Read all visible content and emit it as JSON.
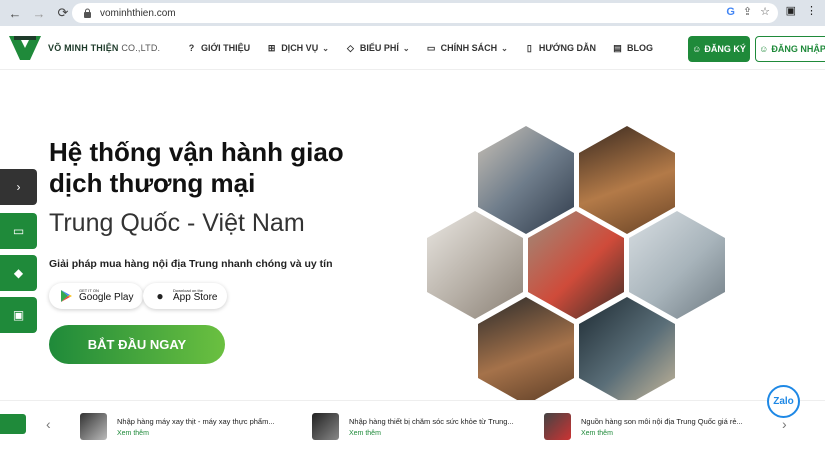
{
  "browser": {
    "url": "vominhthien.com",
    "icons": [
      "back-icon",
      "forward-icon",
      "reload-icon",
      "lock-icon",
      "google-icon",
      "share-icon",
      "star-icon",
      "sidebar-icon",
      "menu-icon"
    ]
  },
  "header": {
    "brand": "VÕ MINH THIỆN",
    "brand_sub": "CO.,LTD.",
    "menu": [
      {
        "label": "GIỚI THIỆU",
        "icon": "help-circle-icon",
        "dropdown": false
      },
      {
        "label": "DỊCH VỤ",
        "icon": "grid-icon",
        "dropdown": true
      },
      {
        "label": "BIỂU PHÍ",
        "icon": "tag-icon",
        "dropdown": true
      },
      {
        "label": "CHÍNH SÁCH",
        "icon": "briefcase-icon",
        "dropdown": true
      },
      {
        "label": "HƯỚNG DẪN",
        "icon": "document-icon",
        "dropdown": false
      },
      {
        "label": "BLOG",
        "icon": "newspaper-icon",
        "dropdown": false
      }
    ],
    "register_label": "ĐĂNG KÝ",
    "login_label": "ĐĂNG NHẬP"
  },
  "hero": {
    "title": "Hệ thống vận hành giao dịch thương mại",
    "subtitle": "Trung Quốc - Việt Nam",
    "tagline": "Giải pháp mua hàng nội địa Trung nhanh chóng và uy tín",
    "google_play_small": "GET IT ON",
    "google_play_big": "Google Play",
    "app_store_small": "Download on the",
    "app_store_big": "App Store",
    "cta_label": "BẮT ĐẦU NGAY"
  },
  "side_tabs": [
    {
      "icon": "chevron-right-icon",
      "color": "#333333"
    },
    {
      "icon": "card-icon",
      "color": "#1f8a3a"
    },
    {
      "icon": "tag-icon",
      "color": "#1f8a3a"
    },
    {
      "icon": "truck-icon",
      "color": "#1f8a3a"
    }
  ],
  "news": [
    {
      "title": "Nhập hàng máy xay thịt - máy xay thực phẩm...",
      "more": "Xem thêm"
    },
    {
      "title": "Nhập hàng thiết bị chăm sóc sức khỏe từ Trung...",
      "more": "Xem thêm"
    },
    {
      "title": "Nguồn hàng son môi nội địa Trung Quốc giá rẻ...",
      "more": "Xem thêm"
    }
  ],
  "zalo_label": "Zalo",
  "colors": {
    "brand_green": "#1f8a3a",
    "accent_green": "#6bc040"
  }
}
